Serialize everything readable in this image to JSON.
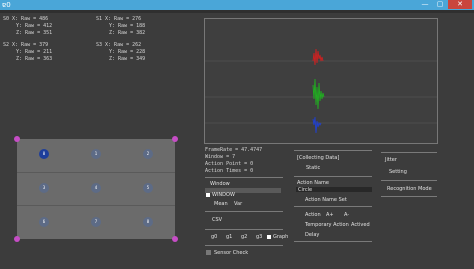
{
  "window": {
    "title_glyph": "ɐ0",
    "minimize_glyph": "—",
    "maximize_glyph": "▢",
    "close_glyph": "✕"
  },
  "readouts": {
    "s0": [
      "S0 X: Raw = 486",
      "Y: Raw = 412",
      "Z: Raw = 351"
    ],
    "s1": [
      "S1 X: Raw = 276",
      "Y: Raw = 188",
      "Z: Raw = 382"
    ],
    "s2": [
      "S2 X: Raw = 379",
      "Y: Raw = 211",
      "Z: Raw = 363"
    ],
    "s3": [
      "S3 X: Raw = 262",
      "Y: Raw = 228",
      "Z: Raw = 349"
    ]
  },
  "grid": {
    "cells": [
      "0",
      "1",
      "2",
      "3",
      "4",
      "5",
      "6",
      "7",
      "8"
    ],
    "selected": "0"
  },
  "plot": {
    "colors": [
      "#d02020",
      "#20b020",
      "#2040d0"
    ]
  },
  "stats": {
    "frame_rate": "FrameRate = 47.4747",
    "window": "Window = 7",
    "action_point": "Action Point = 0",
    "action_times": "Action Times = 0"
  },
  "controls": {
    "window_label": "Window",
    "window_value": "WINDOW",
    "mean": "Mean",
    "var": "Var",
    "csv": "CSV",
    "g0": "g0",
    "g1": "g1",
    "g2": "g2",
    "g3": "g3",
    "graph": "Graph",
    "sensor_check": "Sensor Check"
  },
  "action": {
    "collecting": "[Collecting Data]",
    "state": "Static",
    "name_label": "Action Name",
    "name_value": "Circle",
    "action_name_set": "Action Name Set",
    "action": "Action",
    "a_plus": "A+",
    "a_minus": "A-",
    "temporary": "Temporary Action",
    "actived": "Actived",
    "delay": "Delay"
  },
  "right": {
    "jitter": "Jitter",
    "setting": "Setting",
    "recognition": "Recognition Mode"
  }
}
